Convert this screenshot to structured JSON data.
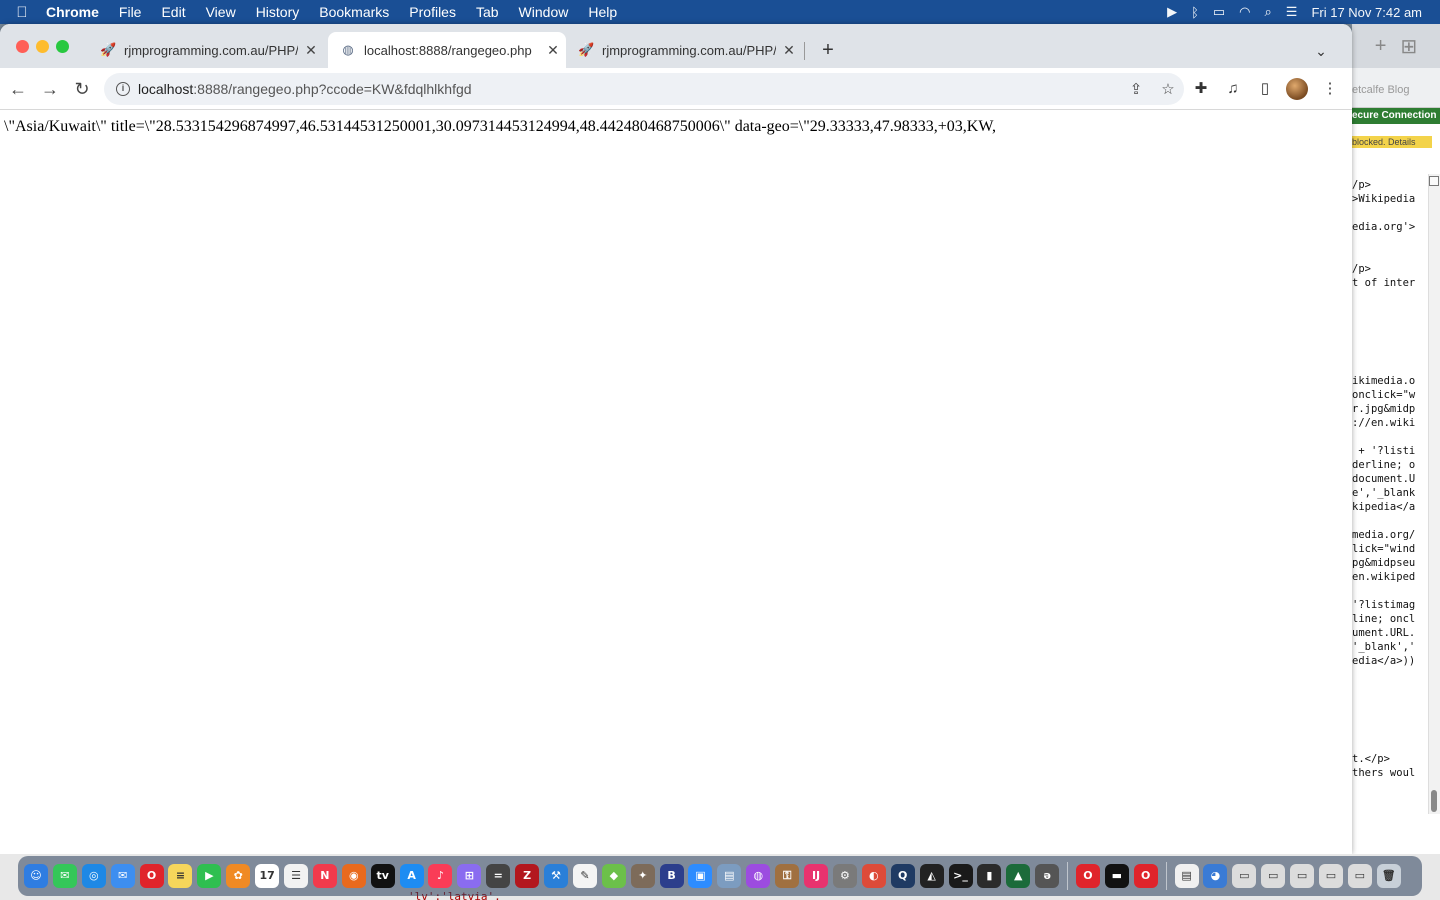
{
  "menubar": {
    "apple_icon": "apple-logo-icon",
    "app_name": "Chrome",
    "items": [
      "File",
      "Edit",
      "View",
      "History",
      "Bookmarks",
      "Profiles",
      "Tab",
      "Window",
      "Help"
    ],
    "datetime": "Fri 17 Nov  7:42 am"
  },
  "browser": {
    "tabs": [
      {
        "title": "rjmprogramming.com.au/PHP/",
        "favicon": "rocket-favicon-icon",
        "active": false
      },
      {
        "title": "localhost:8888/rangegeo.php",
        "favicon": "globe-favicon-icon",
        "active": true
      },
      {
        "title": "rjmprogramming.com.au/PHP/",
        "favicon": "rocket-favicon-icon",
        "active": false
      }
    ],
    "url_host": "localhost",
    "url_rest": ":8888/rangegeo.php?ccode=KW&fdqlhlkhfgd"
  },
  "page": {
    "text": "\\\"Asia/Kuwait\\\" title=\\\"28.533154296874997,46.53144531250001,30.097314453124994,48.442480468750006\\\" data-geo=\\\"29.33333,47.98333,+03,KW,"
  },
  "background_window": {
    "blog_label": "etcalfe Blog",
    "secure_label": "ecure Connection",
    "blocked_label": "blocked. Details",
    "code_lines": [
      "/p>",
      ">Wikipedia",
      "",
      "edia.org'>",
      "",
      "",
      "/p>",
      "t of inter",
      "",
      "",
      "",
      "",
      "",
      "",
      "ikimedia.o",
      "onclick=\"w",
      "r.jpg&midp",
      "://en.wiki",
      "",
      " + '?listi",
      "derline; o",
      "document.U",
      "e','_blank",
      "kipedia</a",
      "",
      "media.org/",
      "lick=\"wind",
      "pg&midpseu",
      "en.wikiped",
      "",
      "'?listimag",
      "line; oncl",
      "ument.URL.",
      "'_blank','",
      "edia</a>))",
      "",
      "",
      "",
      "",
      "",
      "",
      "t.</p>",
      "thers woul"
    ]
  },
  "behind_dock": {
    "code": "'lv':'latvia',"
  },
  "dock": {
    "icons": [
      {
        "name": "finder-icon",
        "color": "#2f7de1",
        "glyph": "☺"
      },
      {
        "name": "messages-icon",
        "color": "#34c759",
        "glyph": "✉"
      },
      {
        "name": "safari-icon",
        "color": "#1e88e5",
        "glyph": "◎"
      },
      {
        "name": "mail-icon",
        "color": "#3d8ef0",
        "glyph": "✉"
      },
      {
        "name": "opera-icon",
        "color": "#e0242b",
        "glyph": "O"
      },
      {
        "name": "notes-icon",
        "color": "#f6d65b",
        "glyph": "≡"
      },
      {
        "name": "facetime-icon",
        "color": "#2fbf50",
        "glyph": "▶"
      },
      {
        "name": "photos-icon",
        "color": "#f08a24",
        "glyph": "✿"
      },
      {
        "name": "calendar-icon",
        "color": "#ffffff",
        "glyph": "17"
      },
      {
        "name": "reminders-icon",
        "color": "#f2f2f2",
        "glyph": "☰"
      },
      {
        "name": "news-icon",
        "color": "#f23a4c",
        "glyph": "N"
      },
      {
        "name": "firefox-icon",
        "color": "#e96a1d",
        "glyph": "◉"
      },
      {
        "name": "appletv-icon",
        "color": "#111111",
        "glyph": "tv"
      },
      {
        "name": "appstore-icon",
        "color": "#1d8cf2",
        "glyph": "A"
      },
      {
        "name": "music-icon",
        "color": "#fa3c57",
        "glyph": "♪"
      },
      {
        "name": "launchpad-icon",
        "color": "#8a6cf0",
        "glyph": "⊞"
      },
      {
        "name": "calculator-icon",
        "color": "#444444",
        "glyph": "="
      },
      {
        "name": "filezilla-icon",
        "color": "#b3171e",
        "glyph": "Z"
      },
      {
        "name": "xcode-icon",
        "color": "#2a7fd8",
        "glyph": "⚒"
      },
      {
        "name": "textedit-icon",
        "color": "#f4f4f4",
        "glyph": "✎"
      },
      {
        "name": "maps-icon",
        "color": "#6cc04a",
        "glyph": "◆"
      },
      {
        "name": "gimp-icon",
        "color": "#7d6b5a",
        "glyph": "✦"
      },
      {
        "name": "bbedit-icon",
        "color": "#2c3e8c",
        "glyph": "B"
      },
      {
        "name": "zoom-icon",
        "color": "#2d8cff",
        "glyph": "▣"
      },
      {
        "name": "preview-icon",
        "color": "#7c9cc0",
        "glyph": "▤"
      },
      {
        "name": "podcasts-icon",
        "color": "#9c4ce0",
        "glyph": "◍"
      },
      {
        "name": "keychain-icon",
        "color": "#a07040",
        "glyph": "⚿"
      },
      {
        "name": "intellij-icon",
        "color": "#e8336e",
        "glyph": "IJ"
      },
      {
        "name": "systemprefs-icon",
        "color": "#7a7a7a",
        "glyph": "⚙"
      },
      {
        "name": "chrome-icon",
        "color": "#dd4b39",
        "glyph": "◐"
      },
      {
        "name": "quicktime-icon",
        "color": "#1f3a63",
        "glyph": "Q"
      },
      {
        "name": "inkscape-icon",
        "color": "#222222",
        "glyph": "◭"
      },
      {
        "name": "terminal-icon",
        "color": "#1a1a1a",
        "glyph": ">_"
      },
      {
        "name": "console-icon",
        "color": "#2b2b2b",
        "glyph": "▮"
      },
      {
        "name": "affinity-icon",
        "color": "#1c6b3a",
        "glyph": "▲"
      },
      {
        "name": "elephant-icon",
        "color": "#555555",
        "glyph": "ǝ"
      },
      {
        "name": "opera-2-icon",
        "color": "#e0242b",
        "glyph": "O"
      },
      {
        "name": "terminal-2-icon",
        "color": "#111111",
        "glyph": "▬"
      },
      {
        "name": "opera-3-icon",
        "color": "#e0242b",
        "glyph": "O"
      },
      {
        "name": "doc-icon",
        "color": "#f0f0f0",
        "glyph": "▤"
      },
      {
        "name": "network-icon",
        "color": "#3a7bd5",
        "glyph": "◕"
      },
      {
        "name": "screenshot-1-icon",
        "color": "#dcdcdc",
        "glyph": "▭"
      },
      {
        "name": "screenshot-2-icon",
        "color": "#dcdcdc",
        "glyph": "▭"
      },
      {
        "name": "screenshot-3-icon",
        "color": "#dcdcdc",
        "glyph": "▭"
      },
      {
        "name": "screenshot-4-icon",
        "color": "#dcdcdc",
        "glyph": "▭"
      },
      {
        "name": "screenshot-5-icon",
        "color": "#dcdcdc",
        "glyph": "▭"
      },
      {
        "name": "trash-icon",
        "color": "#c8d0d8",
        "glyph": "🗑"
      }
    ]
  }
}
